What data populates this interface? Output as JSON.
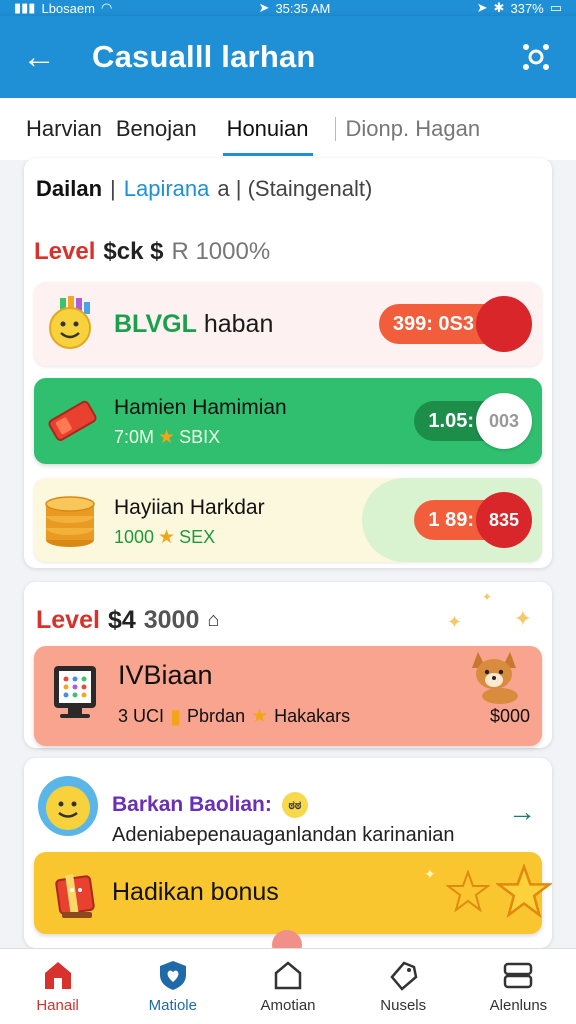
{
  "status_bar": {
    "carrier": "Lbosaem",
    "time": "35:35 AM",
    "battery": "337%"
  },
  "app_bar": {
    "title": "Casualll larhan"
  },
  "tabs": [
    {
      "label": "Harvian",
      "state": "normal"
    },
    {
      "label": "Benojan",
      "state": "normal"
    },
    {
      "label": "Honuian",
      "state": "active"
    },
    {
      "label": "Dionp. Hagan",
      "state": "muted"
    }
  ],
  "filters": {
    "primary": "Dailan",
    "separator": "|",
    "secondary": "Lapirana",
    "tertiary": "a | (Staingenalt)"
  },
  "level_section_1": {
    "label": "Level",
    "count": "$ck $",
    "percent": "R 1000%"
  },
  "rewards": [
    {
      "title_green": "BLVGL",
      "title": "haban",
      "pill": "399: 0S3",
      "dot": ""
    },
    {
      "title": "Hamien Hamimian",
      "sub_left": "7:0M",
      "sub_right": "SBIX",
      "pill": "1.05:",
      "dot": "003"
    },
    {
      "title": "Hayiian Harkdar",
      "sub_left": "1000",
      "sub_right": "SEX",
      "pill": "1 89:",
      "dot": "835"
    }
  ],
  "level_section_2": {
    "label": "Level",
    "count": "$4",
    "number": "3000"
  },
  "promo": {
    "title": "IVBiaan",
    "sub_left": "3 UCI",
    "sub_mid": "Pbrdan",
    "sub_right": "Hakakars",
    "value": "$000"
  },
  "mention": {
    "title": "Barkan Baolian:",
    "emoji": "ಠಠ",
    "subtitle": "Adeniabepenauaganlandan karinanian"
  },
  "bonus": {
    "title": "Hadikan bonus"
  },
  "bottom_nav": [
    {
      "label": "Hanail",
      "icon": "home-icon",
      "state": "active"
    },
    {
      "label": "Matiole",
      "icon": "heart-shield-icon",
      "state": "secondary"
    },
    {
      "label": "Amotian",
      "icon": "house-outline-icon",
      "state": "normal"
    },
    {
      "label": "Nusels",
      "icon": "tag-icon",
      "state": "normal"
    },
    {
      "label": "Alenluns",
      "icon": "wallet-icon",
      "state": "normal"
    }
  ],
  "colors": {
    "primary": "#1f8fd6",
    "accent_red": "#d8322d",
    "green": "#2fbf6f",
    "yellow": "#f9c630",
    "salmon": "#f8a48f"
  }
}
